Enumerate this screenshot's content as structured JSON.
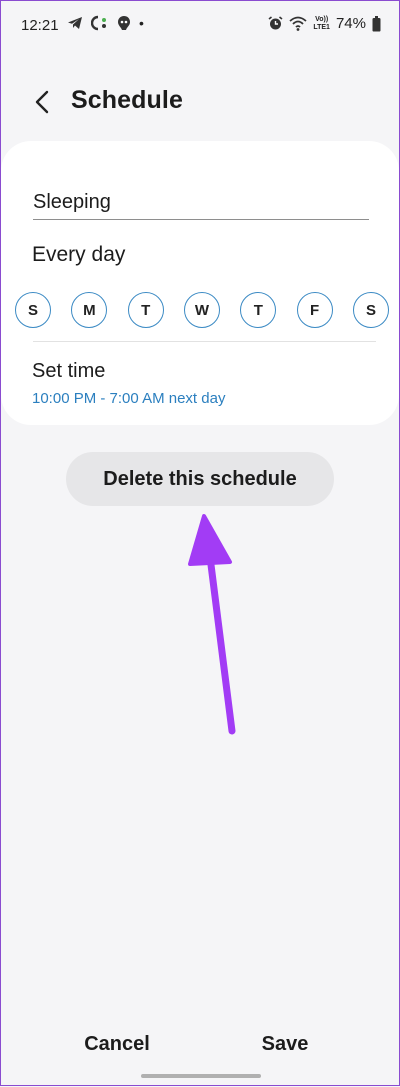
{
  "status_bar": {
    "time": "12:21",
    "dot": "•",
    "battery": "74%",
    "left_icons": [
      "telegram-icon",
      "messaging-icon",
      "shield-icon"
    ],
    "right_icons": [
      "alarm-icon",
      "wifi-icon",
      "volte-icon",
      "battery-icon"
    ],
    "volte_top": "Vo))",
    "volte_bottom": "LTE1"
  },
  "header": {
    "title": "Schedule",
    "back_icon": "chevron-left-icon"
  },
  "schedule": {
    "name_value": "Sleeping",
    "repeat_label": "Every day",
    "days": [
      "S",
      "M",
      "T",
      "W",
      "T",
      "F",
      "S"
    ],
    "day_border_color": "#3b8ac4",
    "set_time_label": "Set time",
    "set_time_value": "10:00 PM - 7:00 AM next day",
    "accent_color": "#2b7fbf"
  },
  "delete_label": "Delete this schedule",
  "annotation": {
    "arrow_color": "#a23cf5"
  },
  "bottom": {
    "cancel_label": "Cancel",
    "save_label": "Save"
  }
}
